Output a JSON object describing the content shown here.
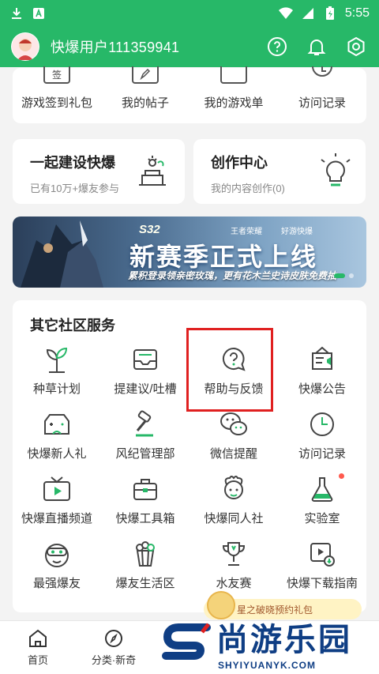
{
  "statusbar": {
    "time": "5:55"
  },
  "appbar": {
    "username": "快爆用户111359941"
  },
  "quick_items": [
    {
      "label": "游戏签到礼包",
      "icon_text": "签"
    },
    {
      "label": "我的帖子",
      "icon_text": ""
    },
    {
      "label": "我的游戏单",
      "icon_text": ""
    },
    {
      "label": "访问记录",
      "icon_text": ""
    }
  ],
  "build_card": {
    "title": "一起建设快爆",
    "subtitle": "已有10万+爆友参与"
  },
  "create_card": {
    "title": "创作中心",
    "subtitle": "我的内容创作(0)"
  },
  "banner": {
    "tag": "S32",
    "brand1": "王者荣耀",
    "brand2": "好游快爆",
    "title": "新赛季正式上线",
    "subtitle": "累积登录领亲密玫瑰，更有花木兰史诗皮肤免费抽"
  },
  "services": {
    "title": "其它社区服务",
    "items": [
      {
        "label": "种草计划",
        "icon": "sprout-icon"
      },
      {
        "label": "提建议/吐槽",
        "icon": "suggestion-box-icon"
      },
      {
        "label": "帮助与反馈",
        "icon": "help-icon"
      },
      {
        "label": "快爆公告",
        "icon": "announcement-icon"
      },
      {
        "label": "快爆新人礼",
        "icon": "newcomer-gift-icon"
      },
      {
        "label": "风纪管理部",
        "icon": "gavel-icon"
      },
      {
        "label": "微信提醒",
        "icon": "wechat-icon"
      },
      {
        "label": "访问记录",
        "icon": "clock-icon"
      },
      {
        "label": "快爆直播频道",
        "icon": "live-tv-icon"
      },
      {
        "label": "快爆工具箱",
        "icon": "toolbox-icon"
      },
      {
        "label": "快爆同人社",
        "icon": "fan-art-icon"
      },
      {
        "label": "实验室",
        "icon": "flask-icon"
      },
      {
        "label": "最强爆友",
        "icon": "vr-face-icon"
      },
      {
        "label": "爆友生活区",
        "icon": "popcorn-icon"
      },
      {
        "label": "水友赛",
        "icon": "trophy-icon"
      },
      {
        "label": "快爆下载指南",
        "icon": "download-guide-icon"
      }
    ]
  },
  "float_badge": {
    "text": "星之破晓预约礼包"
  },
  "bottom_nav": [
    {
      "label": "首页",
      "icon": "home-icon"
    },
    {
      "label": "分类·新奇",
      "icon": "compass-icon"
    }
  ],
  "watermark": {
    "main": "尚游乐园",
    "sub": "SHYIYUANYK.COM"
  },
  "colors": {
    "brand": "#27b868",
    "highlight": "#e02020",
    "watermark": "#0f3e84"
  }
}
